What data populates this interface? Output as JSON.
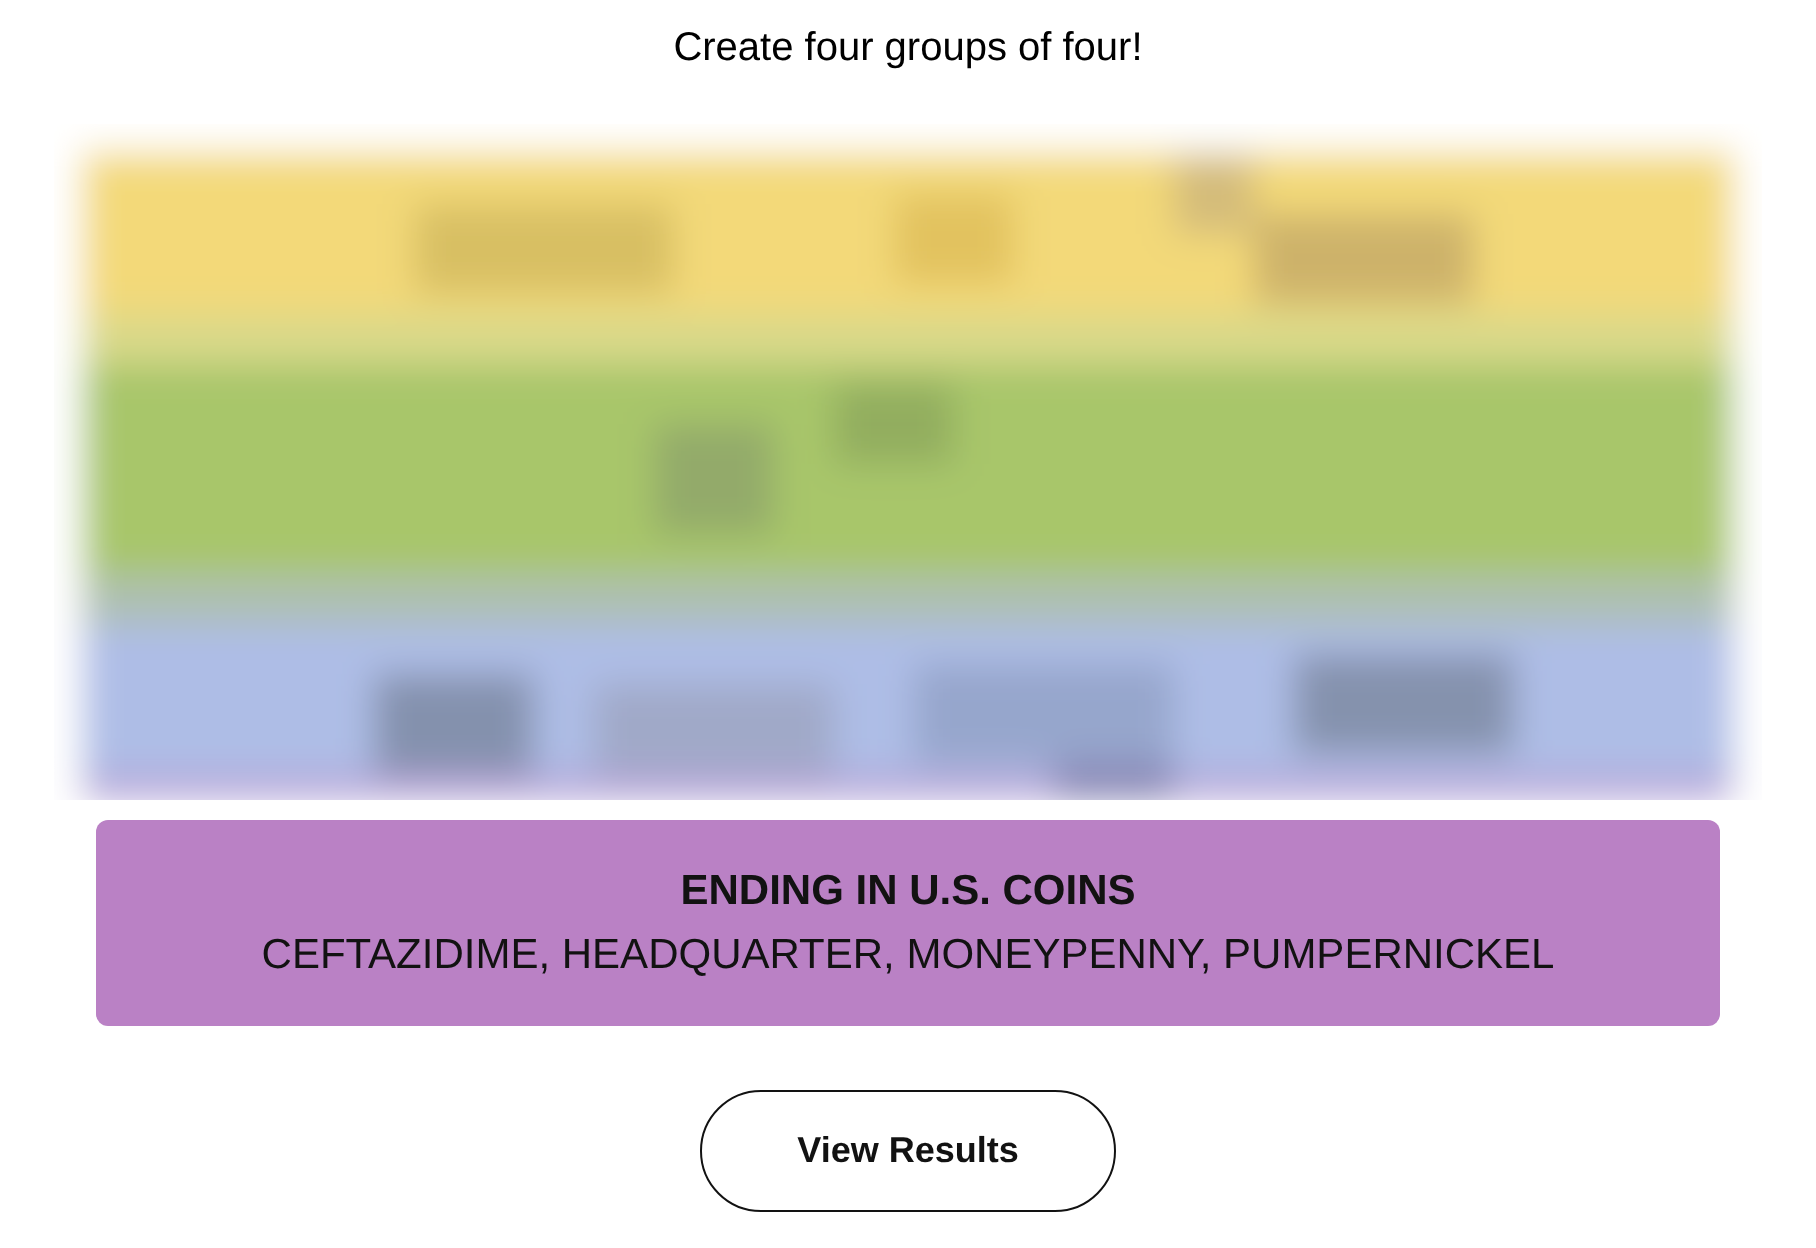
{
  "instructions": "Create four groups of four!",
  "solved_groups": [
    {
      "title": "ENDING IN U.S. COINS",
      "members": "CEFTAZIDIME, HEADQUARTER, MONEYPENNY, PUMPERNICKEL",
      "color": "#ba81c5"
    }
  ],
  "buttons": [
    {
      "label": "View Results"
    }
  ]
}
